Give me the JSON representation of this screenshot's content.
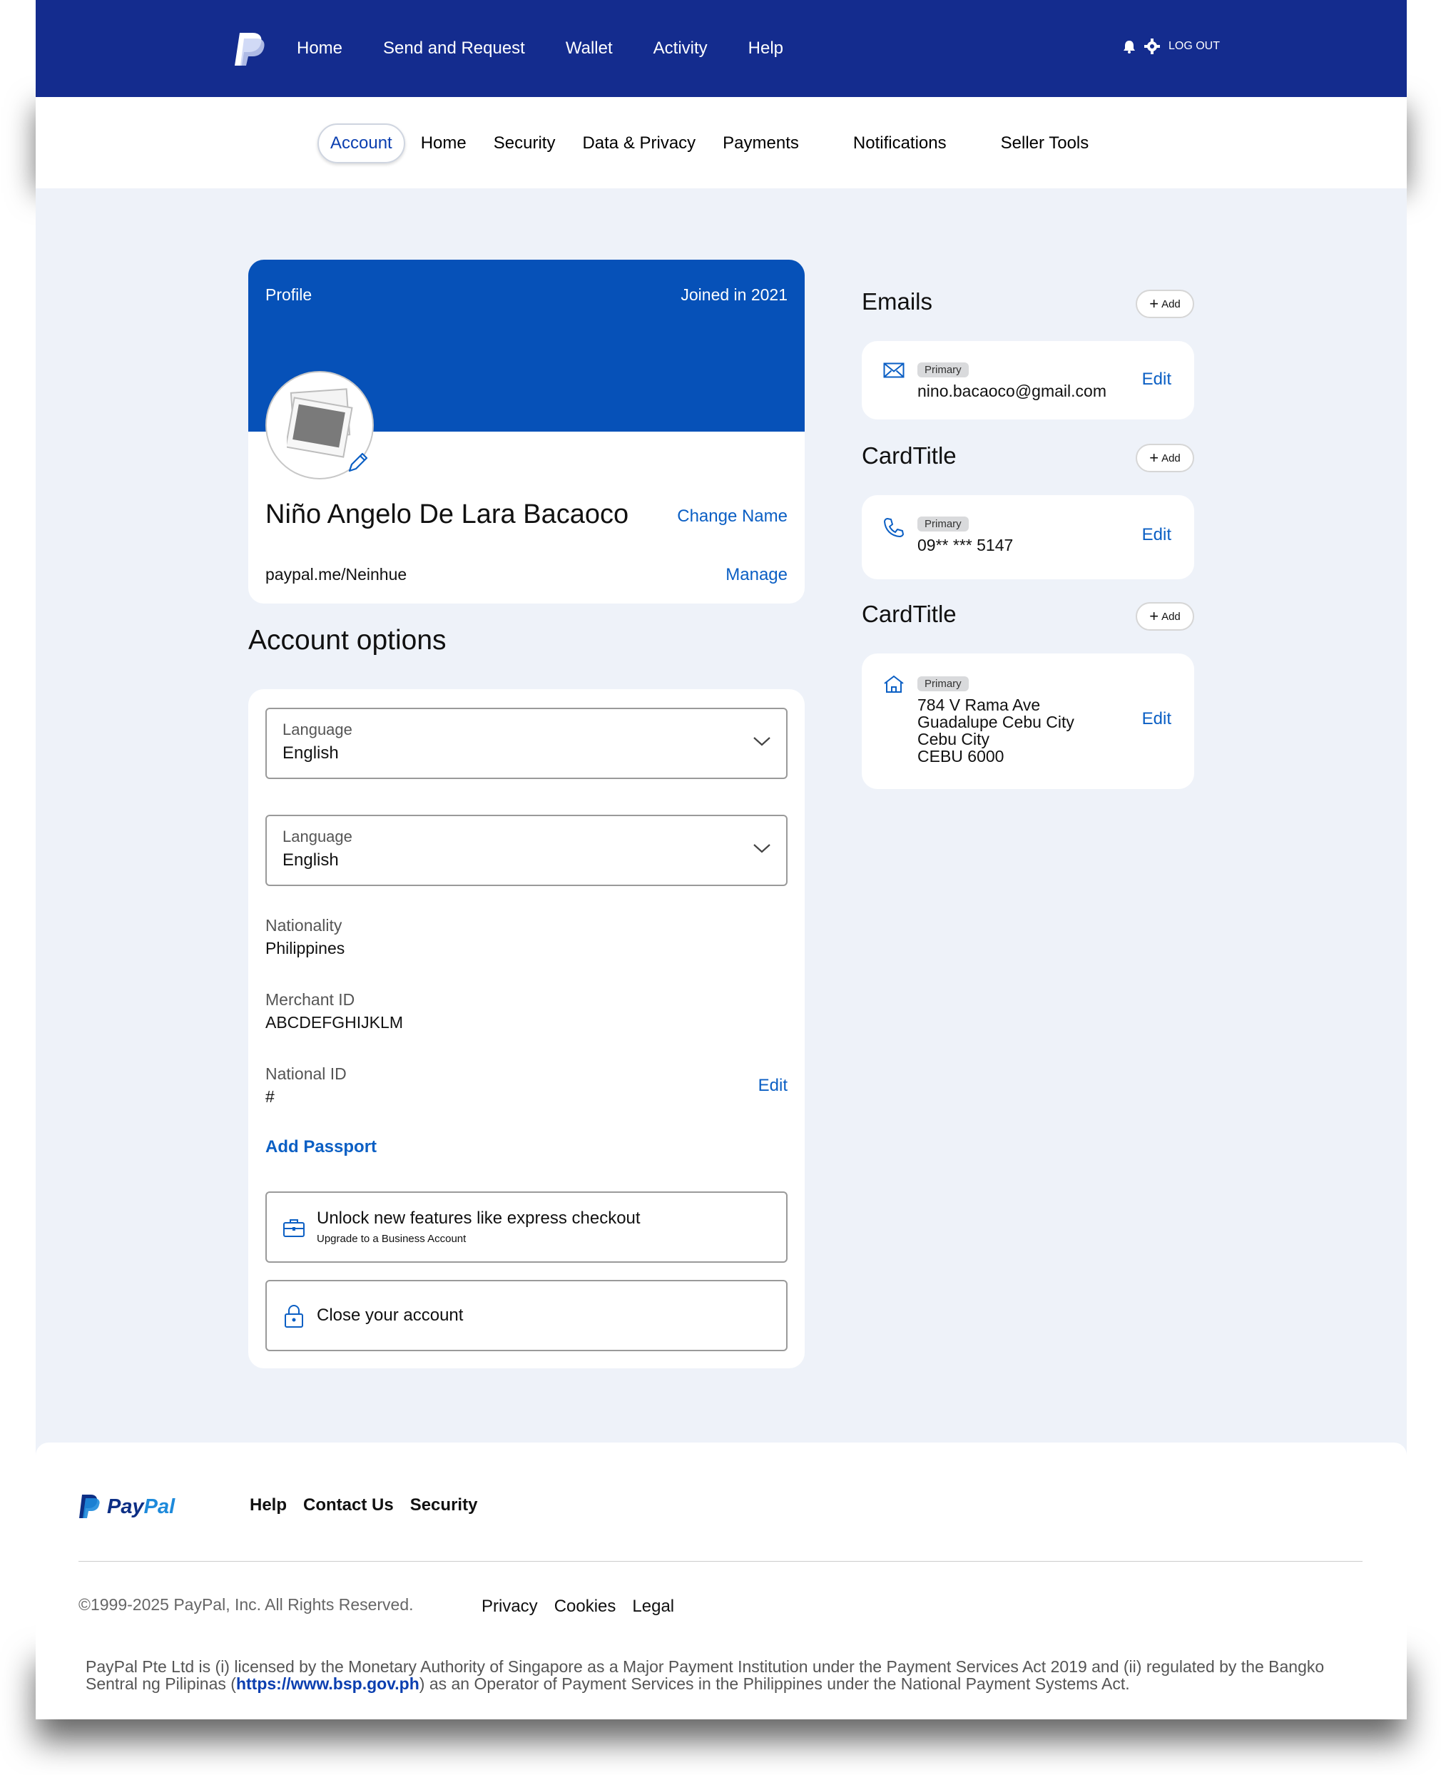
{
  "topnav": {
    "links": [
      "Home",
      "Send and Request",
      "Wallet",
      "Activity",
      "Help"
    ],
    "logout": "LOG OUT"
  },
  "subnav": {
    "tabs": [
      "Account",
      "Home",
      "Security",
      "Data & Privacy",
      "Payments",
      "Notifications",
      "Seller Tools"
    ],
    "active": "Account"
  },
  "profile": {
    "header_left": "Profile",
    "header_right": "Joined in 2021",
    "name": "Niño Angelo De Lara Bacaoco",
    "change_name": "Change Name",
    "handle": "paypal.me/Neinhue",
    "manage": "Manage"
  },
  "account_options": {
    "title": "Account options",
    "select1": {
      "label": "Language",
      "value": "English"
    },
    "select2": {
      "label": "Language",
      "value": "English"
    },
    "nationality": {
      "label": "Nationality",
      "value": "Philippines"
    },
    "merchant": {
      "label": "Merchant ID",
      "value": "ABCDEFGHIJKLM"
    },
    "national_id": {
      "label": "National ID",
      "value": "#",
      "edit": "Edit"
    },
    "add_passport": "Add Passport",
    "upgrade": {
      "title": "Unlock new features like express checkout",
      "subtitle": "Upgrade to a Business Account"
    },
    "close": "Close your account"
  },
  "right": {
    "add_label": "Add",
    "emails": {
      "title": "Emails",
      "badge": "Primary",
      "value": "nino.bacaoco@gmail.com",
      "edit": "Edit"
    },
    "phone": {
      "title": "CardTitle",
      "badge": "Primary",
      "value": "09** *** 5147",
      "edit": "Edit"
    },
    "address": {
      "title": "CardTitle",
      "badge": "Primary",
      "lines": [
        "784 V Rama Ave",
        "Guadalupe Cebu City",
        "Cebu City",
        "CEBU 6000"
      ],
      "edit": "Edit"
    }
  },
  "footer": {
    "brand_pay": "Pay",
    "brand_pal": "Pal",
    "links": [
      "Help",
      "Contact Us",
      "Security"
    ],
    "copyright": "©1999-2025 PayPal, Inc. All Rights Reserved.",
    "legal_links": [
      "Privacy",
      "Cookies",
      "Legal"
    ],
    "legal_pre": "PayPal Pte Ltd is (i) licensed by the Monetary Authority of Singapore as a Major Payment Institution under the Payment Services Act 2019 and (ii) regulated by the Bangko Sentral ng Pilipinas (",
    "legal_link": "https://www.bsp.gov.ph",
    "legal_post": ") as an Operator of Payment Services in the Philippines under the National Payment Systems Act."
  },
  "colors": {
    "nav": "#142c8e",
    "banner": "#0651b8",
    "link": "#0b5fc4",
    "page_bg": "#eef2f9"
  }
}
